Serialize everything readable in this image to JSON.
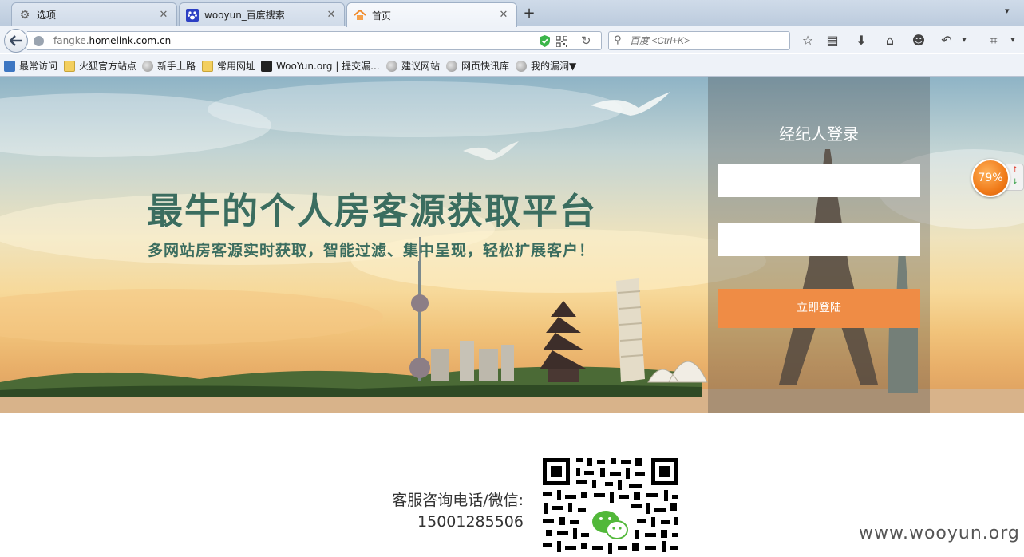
{
  "browser": {
    "tabs": [
      {
        "label": "选项",
        "icon": "gear-icon"
      },
      {
        "label": "wooyun_百度搜索",
        "icon": "baidu-paw-icon"
      },
      {
        "label": "首页",
        "icon": "house-icon"
      }
    ],
    "url_prefix": "fangke.",
    "url_host": "homelink.com.cn",
    "search_placeholder": "百度 <Ctrl+K>",
    "bookmarks": [
      {
        "label": "最常访问",
        "icon": "most-visited-icon"
      },
      {
        "label": "火狐官方站点",
        "icon": "folder-icon"
      },
      {
        "label": "新手上路",
        "icon": "globe-icon"
      },
      {
        "label": "常用网址",
        "icon": "folder-icon"
      },
      {
        "label": "WooYun.org | 提交漏...",
        "icon": "wooyun-icon"
      },
      {
        "label": "建议网站",
        "icon": "globe-icon"
      },
      {
        "label": "网页快讯库",
        "icon": "globe-icon"
      },
      {
        "label": "我的漏洞▼",
        "icon": "globe-icon"
      }
    ]
  },
  "hero": {
    "title": "最牛的个人房客源获取平台",
    "subtitle": "多网站房客源实时获取，智能过滤、集中呈现，轻松扩展客户！"
  },
  "login": {
    "title": "经纪人登录",
    "button": "立即登陆"
  },
  "speed": {
    "percent": "79%"
  },
  "footer": {
    "contact_label": "客服咨询电话/微信:",
    "phone": "15001285506",
    "watermark": "www.wooyun.org"
  }
}
